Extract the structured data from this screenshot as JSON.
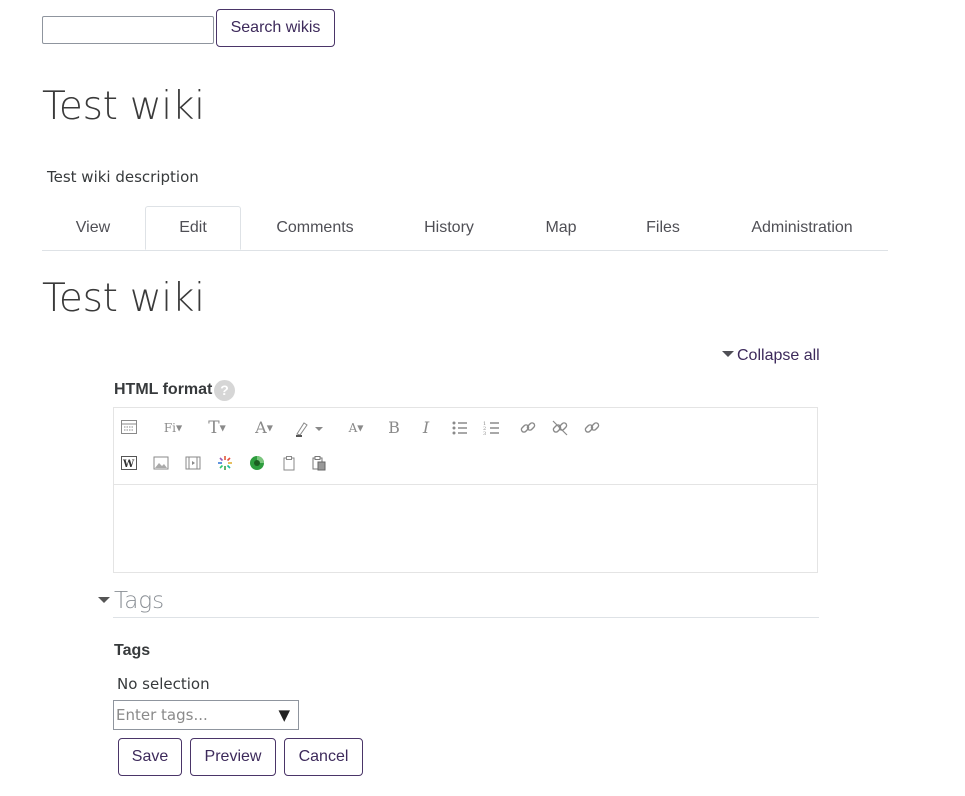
{
  "search": {
    "value": "",
    "placeholder": "",
    "button_label": "Search wikis"
  },
  "page_title": "Test wiki",
  "description": "Test wiki description",
  "tabs": [
    {
      "label": "View",
      "active": false
    },
    {
      "label": "Edit",
      "active": true
    },
    {
      "label": "Comments",
      "active": false
    },
    {
      "label": "History",
      "active": false
    },
    {
      "label": "Map",
      "active": false
    },
    {
      "label": "Files",
      "active": false
    },
    {
      "label": "Administration",
      "active": false
    }
  ],
  "content_title": "Test wiki",
  "collapse_all_label": "Collapse all",
  "editor": {
    "format_label": "HTML format",
    "help_icon": "?",
    "font_family_abbrev": "Fi",
    "content": ""
  },
  "tags_section": {
    "heading": "Tags",
    "field_label": "Tags",
    "selection_text": "No selection",
    "input_placeholder": "Enter tags...",
    "dropdown_arrow": "▼"
  },
  "actions": {
    "save_label": "Save",
    "preview_label": "Preview",
    "cancel_label": "Cancel"
  },
  "colors": {
    "accent": "#3d2a5b",
    "border": "#dee2e6",
    "text": "#373a3c"
  }
}
